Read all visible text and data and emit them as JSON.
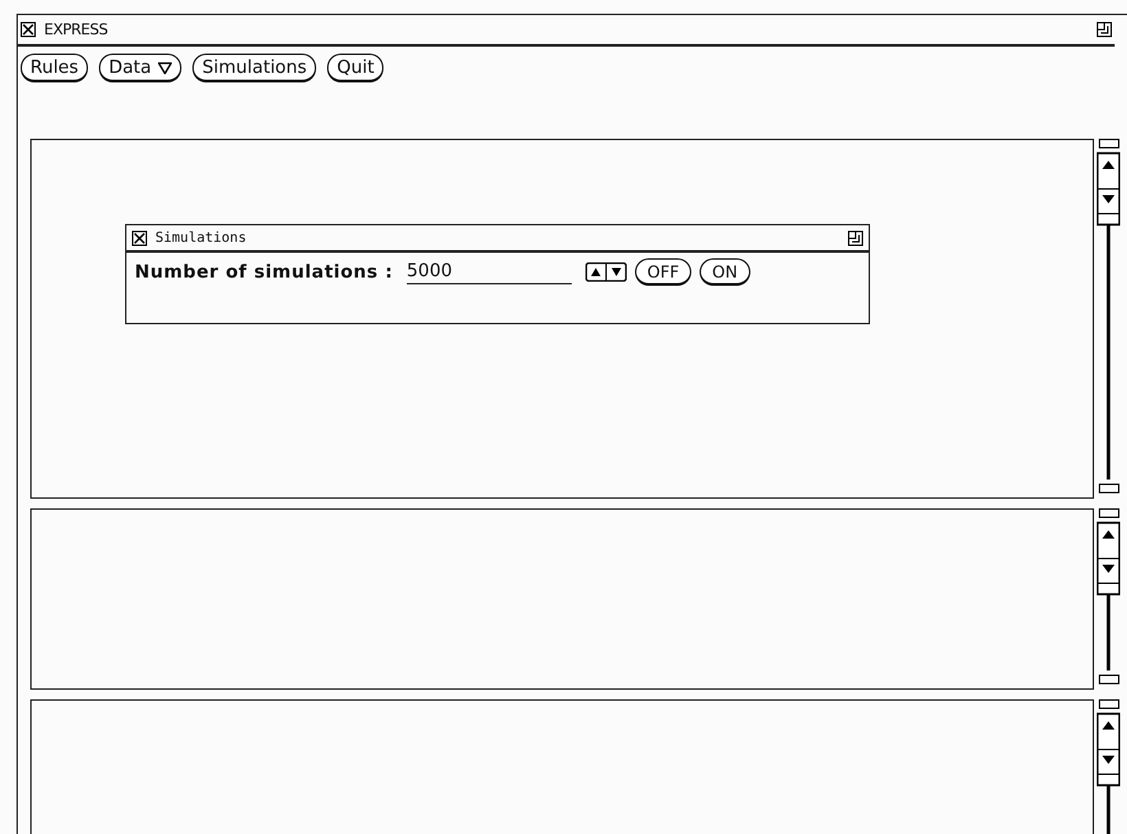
{
  "window": {
    "title": "EXPRESS"
  },
  "buttons": [
    {
      "label": "Rules",
      "menu": false
    },
    {
      "label": "Data",
      "menu": true
    },
    {
      "label": "Simulations",
      "menu": false
    },
    {
      "label": "Quit",
      "menu": false
    }
  ],
  "panes": [
    {
      "kind": "pane"
    },
    {
      "kind": "pane"
    },
    {
      "kind": "pane"
    }
  ],
  "simulations_window": {
    "title": "Simulations",
    "label": "Number of simulations :",
    "value": "5000",
    "buttons": [
      "OFF",
      "ON"
    ]
  }
}
